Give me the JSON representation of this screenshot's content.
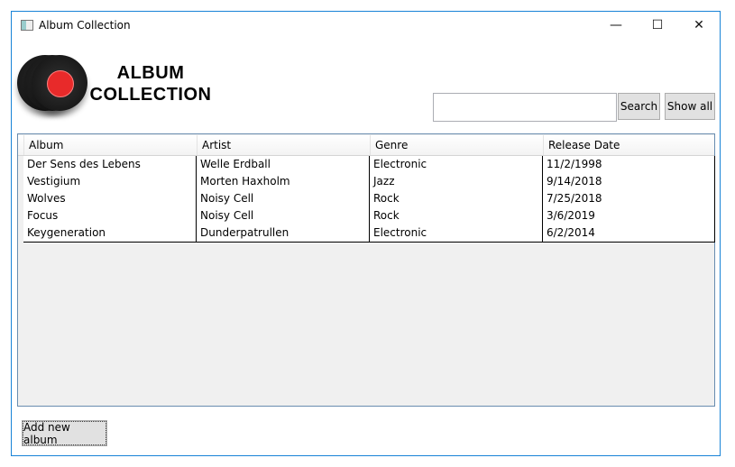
{
  "window": {
    "title": "Album Collection",
    "minimize": "—",
    "maximize": "☐",
    "close": "✕"
  },
  "logo": {
    "line1": "ALBUM",
    "line2": "COLLECTION"
  },
  "search": {
    "value": "",
    "placeholder": "",
    "search_label": "Search",
    "show_all_label": "Show all"
  },
  "table": {
    "columns": [
      "Album",
      "Artist",
      "Genre",
      "Release Date"
    ],
    "rows": [
      [
        "Der Sens des Lebens",
        "Welle Erdball",
        "Electronic",
        "11/2/1998"
      ],
      [
        "Vestigium",
        "Morten Haxholm",
        "Jazz",
        "9/14/2018"
      ],
      [
        "Wolves",
        "Noisy Cell",
        "Rock",
        "7/25/2018"
      ],
      [
        "Focus",
        "Noisy Cell",
        "Rock",
        "3/6/2019"
      ],
      [
        "Keygeneration",
        "Dunderpatrullen",
        "Electronic",
        "6/2/2014"
      ]
    ]
  },
  "footer": {
    "add_label": "Add new album"
  }
}
